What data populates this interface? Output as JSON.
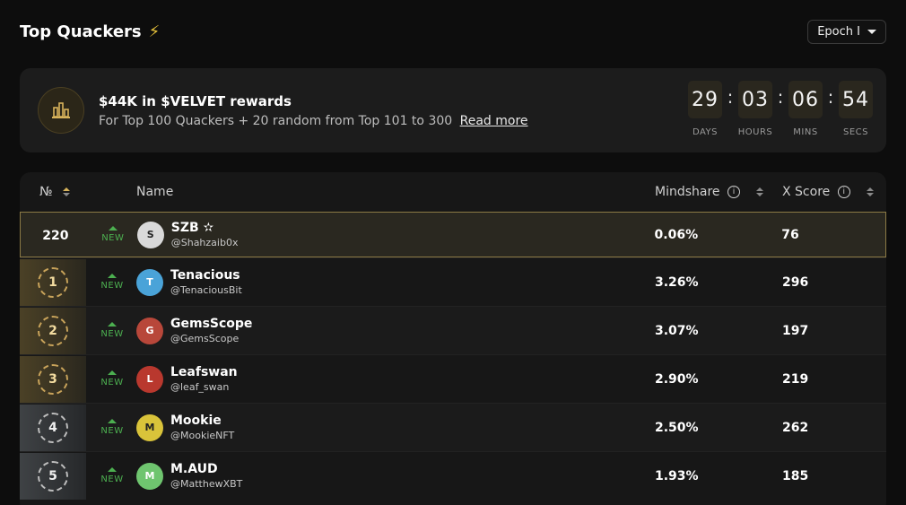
{
  "header": {
    "title": "Top Quackers",
    "epoch_label": "Epoch I"
  },
  "banner": {
    "headline": "$44K in $VELVET rewards",
    "subtitle": "For Top 100 Quackers + 20 random from Top 101 to 300",
    "read_more": "Read more",
    "countdown": [
      {
        "value": "29",
        "label": "DAYS"
      },
      {
        "value": "03",
        "label": "HOURS"
      },
      {
        "value": "06",
        "label": "MINS"
      },
      {
        "value": "54",
        "label": "SECS"
      }
    ]
  },
  "table": {
    "columns": {
      "rank": "№",
      "name": "Name",
      "mindshare": "Mindshare",
      "xscore": "X Score"
    },
    "rows": [
      {
        "rank": "220",
        "new": "NEW",
        "name": "SZB ✫",
        "handle": "@Shahzaib0x",
        "mindshare": "0.06%",
        "xscore": "76",
        "avatar_color": "#d9d9d9"
      },
      {
        "rank": "1",
        "new": "NEW",
        "name": "Tenacious",
        "handle": "@TenaciousBit",
        "mindshare": "3.26%",
        "xscore": "296",
        "avatar_color": "#4aa3d8"
      },
      {
        "rank": "2",
        "new": "NEW",
        "name": "GemsScope",
        "handle": "@GemsScope",
        "mindshare": "3.07%",
        "xscore": "197",
        "avatar_color": "#b8473a"
      },
      {
        "rank": "3",
        "new": "NEW",
        "name": "Leafswan",
        "handle": "@leaf_swan",
        "mindshare": "2.90%",
        "xscore": "219",
        "avatar_color": "#b9382e"
      },
      {
        "rank": "4",
        "new": "NEW",
        "name": "Mookie",
        "handle": "@MookieNFT",
        "mindshare": "2.50%",
        "xscore": "262",
        "avatar_color": "#d9c33a"
      },
      {
        "rank": "5",
        "new": "NEW",
        "name": "M.AUD",
        "handle": "@MatthewXBT",
        "mindshare": "1.93%",
        "xscore": "185",
        "avatar_color": "#6fc56f"
      }
    ]
  }
}
